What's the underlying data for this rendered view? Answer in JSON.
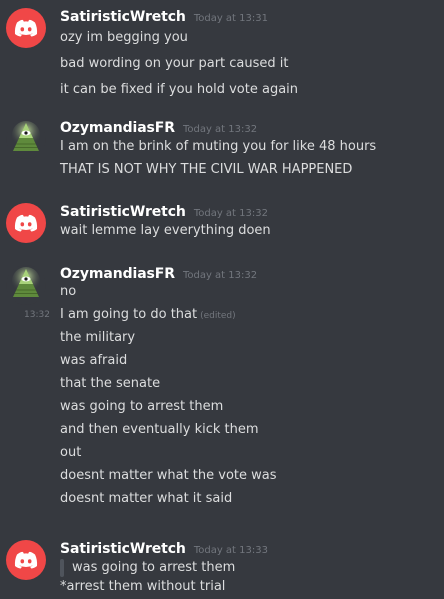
{
  "messages": [
    {
      "username": "SatiristicWretch",
      "timestamp": "Today at 13:31",
      "avatar": "discord-logo",
      "lines": [
        "ozy im begging you",
        "bad wording on your part caused it",
        "it can be fixed if you hold vote again"
      ]
    },
    {
      "username": "OzymandiasFR",
      "timestamp": "Today at 13:32",
      "avatar": "illuminati-pyramid",
      "lines": [
        "I am on the brink of muting you for like 48 hours",
        "THAT IS NOT WHY THE CIVIL WAR HAPPENED"
      ]
    },
    {
      "username": "SatiristicWretch",
      "timestamp": "Today at 13:32",
      "avatar": "discord-logo",
      "lines": [
        "wait lemme lay everything doen"
      ]
    },
    {
      "username": "OzymandiasFR",
      "timestamp": "Today at 13:32",
      "avatar": "illuminati-pyramid",
      "lines": [
        "no",
        "I am going to do that",
        "the military",
        "was afraid",
        "that the senate",
        "was going to arrest them",
        "and then eventually kick them",
        "out",
        "doesnt matter what the vote was",
        "doesnt matter what it said"
      ],
      "side_time": "13:32",
      "edited_label": "(edited)"
    },
    {
      "username": "SatiristicWretch",
      "timestamp": "Today at 13:33",
      "avatar": "discord-logo",
      "quote": "was going to arrest them",
      "lines": [
        "*arrest them without trial"
      ]
    }
  ],
  "colors": {
    "background": "#36393f",
    "username": "#ffffff",
    "text": "#dcddde",
    "muted": "#72767d",
    "discord_avatar": "#f04747",
    "quote_bar": "#4f545c"
  }
}
